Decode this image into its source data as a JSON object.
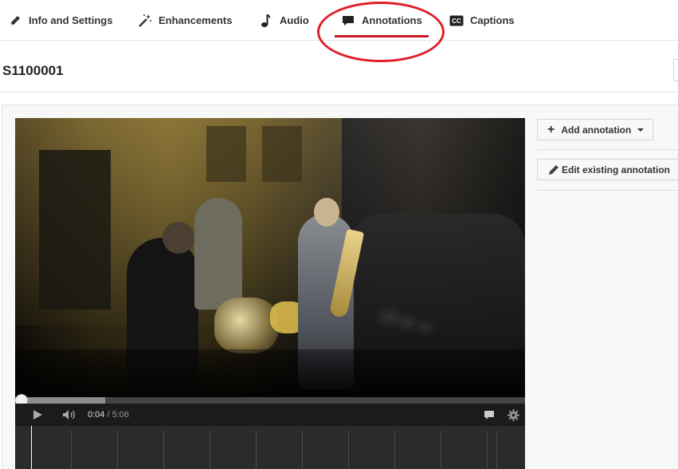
{
  "tabs": [
    {
      "label": "Info and Settings",
      "icon": "pencil-icon"
    },
    {
      "label": "Enhancements",
      "icon": "magic-wand-icon"
    },
    {
      "label": "Audio",
      "icon": "music-note-icon"
    },
    {
      "label": "Annotations",
      "icon": "speech-bubble-icon",
      "active": true
    },
    {
      "label": "Captions",
      "icon": "cc-icon"
    }
  ],
  "video": {
    "title": "S1100001",
    "current_time": "0:04",
    "separator": "/",
    "duration": "5:06",
    "progress_fraction": 0.013,
    "buffered_fraction": 0.177
  },
  "sidebar": {
    "add_annotation_label": "Add annotation",
    "edit_annotation_label": "Edit existing annotation"
  },
  "colors": {
    "accent": "#cc181e",
    "highlight_ellipse": "#dd1f26"
  }
}
